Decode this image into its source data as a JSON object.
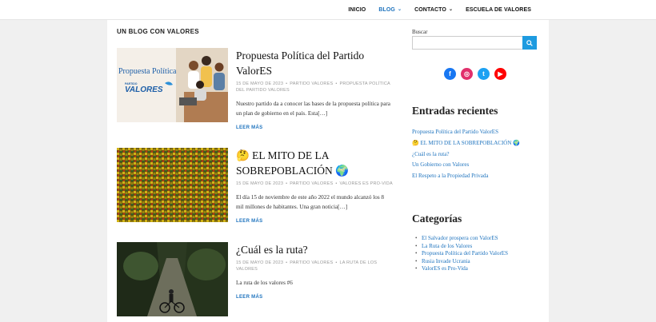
{
  "nav": {
    "items": [
      {
        "label": "INICIO"
      },
      {
        "label": "BLOG",
        "active": true,
        "dropdown": true
      },
      {
        "label": "CONTACTO",
        "dropdown": true
      },
      {
        "label": "ESCUELA DE VALORES"
      }
    ]
  },
  "main": {
    "section_title": "UN BLOG CON VALORES",
    "posts": [
      {
        "title": "Propuesta Política del Partido ValorES",
        "date": "15 DE MAYO DE 2023",
        "author": "PARTIDO VALORES",
        "category": "PROPUESTA POLÍTICA DEL PARTIDO VALORES",
        "excerpt": "Nuestro partido da a conocer las bases de la propuesta política para un plan de gobierno en el país. Esta[…]",
        "more": "LEER MÁS",
        "thumb_caption": "Propuesta Política",
        "thumb_logo_small": "PARTIDO",
        "thumb_logo": "VALORES"
      },
      {
        "title": "🤔 EL MITO DE LA SOBREPOBLACIÓN 🌍",
        "date": "15 DE MAYO DE 2023",
        "author": "PARTIDO VALORES",
        "category": "VALORES ES PRO-VIDA",
        "excerpt": " El día 15 de noviembre de este año 2022 el mundo  alcanzó los 8 mil millones de habitantes. Una gran noticia[…]",
        "more": "LEER MÁS"
      },
      {
        "title": "¿Cuál es la ruta?",
        "date": "15 DE MAYO DE 2023",
        "author": "PARTIDO VALORES",
        "category": "LA RUTA DE LOS VALORES",
        "excerpt": "La ruta de los valores #6",
        "more": "LEER MÁS"
      }
    ]
  },
  "sidebar": {
    "search_label": "Buscar",
    "search_value": "",
    "social": [
      {
        "icon": "facebook-icon",
        "glyph": "f",
        "color": "#1877f2"
      },
      {
        "icon": "instagram-icon",
        "glyph": "◎",
        "color": "#e1306c"
      },
      {
        "icon": "twitter-icon",
        "glyph": "t",
        "color": "#1da1f2"
      },
      {
        "icon": "youtube-icon",
        "glyph": "▶",
        "color": "#ff0000"
      }
    ],
    "recent_title": "Entradas recientes",
    "recent": [
      "Propuesta Política del Partido ValorES",
      "🤔 EL MITO DE LA SOBREPOBLACIÓN 🌍",
      "¿Cuál es la ruta?",
      "Un Gobierno con Valores",
      "El Respeto a la Propiedad Privada"
    ],
    "categories_title": "Categorías",
    "categories": [
      "El Salvador prospera con ValorES",
      "La Ruta de los Valores",
      "Propuesta Política del Partido ValorES",
      "Rusia Invade Ucrania",
      "ValorES es Pro-Vida"
    ]
  }
}
